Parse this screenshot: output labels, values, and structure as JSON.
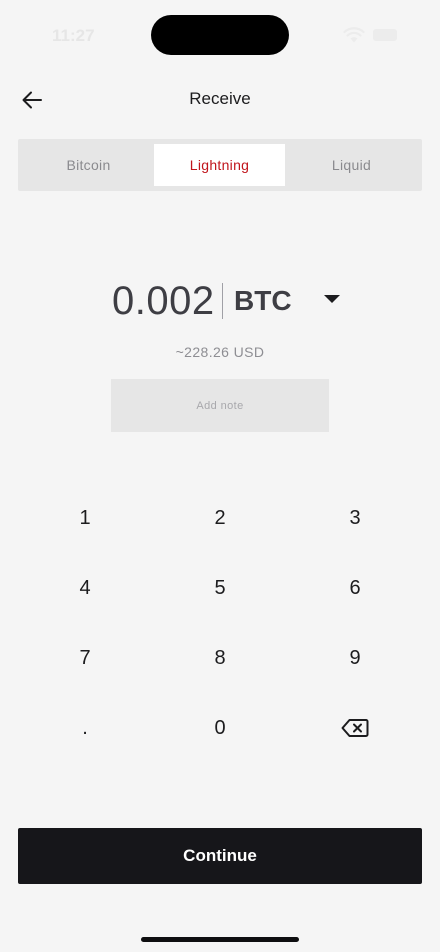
{
  "status_bar": {
    "time": "11:27",
    "icons": [
      "wifi-icon",
      "battery-icon"
    ]
  },
  "header": {
    "title": "Receive",
    "back_icon": "arrow-left-icon"
  },
  "tabs": [
    {
      "label": "Bitcoin",
      "selected": false
    },
    {
      "label": "Lightning",
      "selected": true
    },
    {
      "label": "Liquid",
      "selected": false
    }
  ],
  "colors": {
    "accent": "#c0141b",
    "background": "#f5f5f5",
    "primary_button": "#16161a"
  },
  "amount": {
    "value": "0.002",
    "unit": "BTC",
    "dropdown_icon": "caret-down-icon",
    "fiat": "~228.26 USD"
  },
  "note": {
    "label": "Add note"
  },
  "keypad": {
    "keys": [
      "1",
      "2",
      "3",
      "4",
      "5",
      "6",
      "7",
      "8",
      "9",
      ".",
      "0"
    ],
    "backspace_icon": "backspace-icon"
  },
  "continue_label": "Continue"
}
